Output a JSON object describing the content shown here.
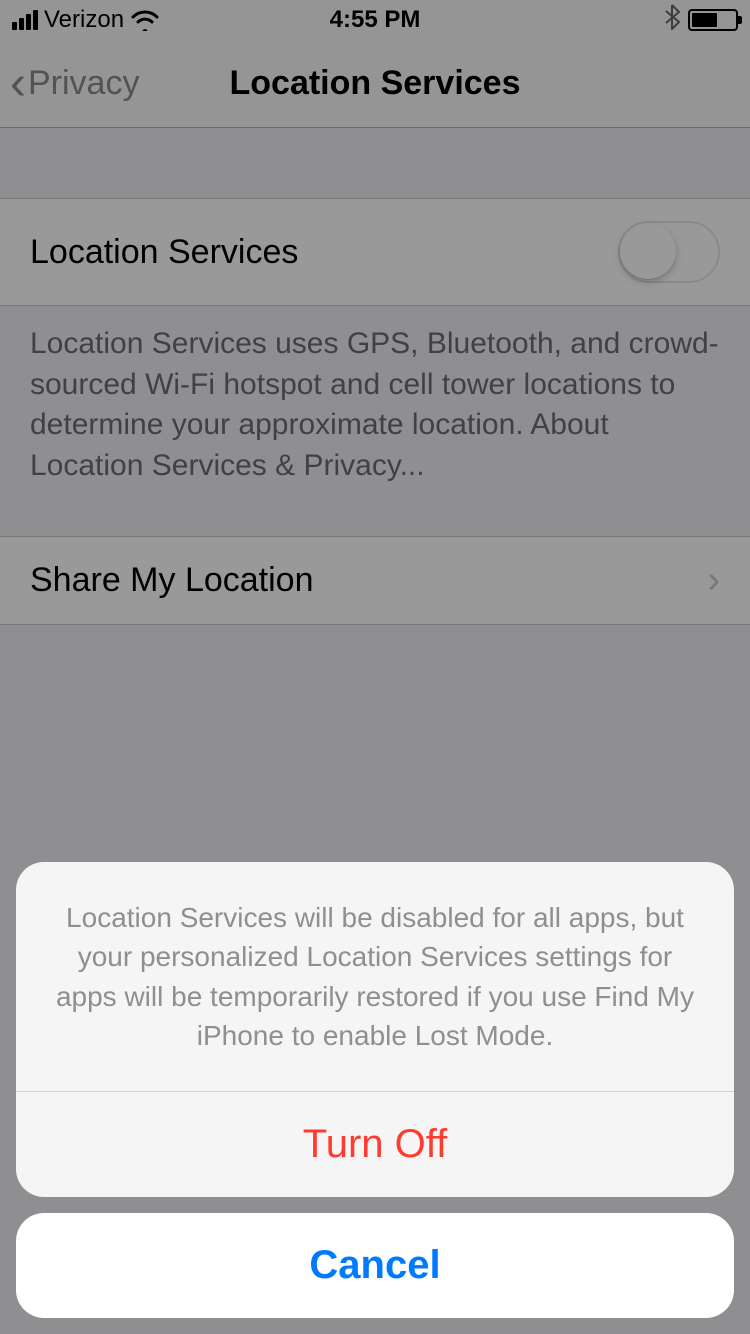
{
  "statusBar": {
    "carrier": "Verizon",
    "time": "4:55 PM"
  },
  "nav": {
    "back": "Privacy",
    "title": "Location Services"
  },
  "main": {
    "toggleLabel": "Location Services",
    "description": "Location Services uses GPS, Bluetooth, and crowd-sourced Wi-Fi hotspot and cell tower locations to determine your approximate location. ",
    "descriptionLink": "About Location Services & Privacy...",
    "shareRow": "Share My Location"
  },
  "sheet": {
    "message": "Location Services will be disabled for all apps, but your personalized Location Services settings for apps will be temporarily restored if you use Find My iPhone to enable Lost Mode.",
    "turnOff": "Turn Off",
    "cancel": "Cancel"
  }
}
